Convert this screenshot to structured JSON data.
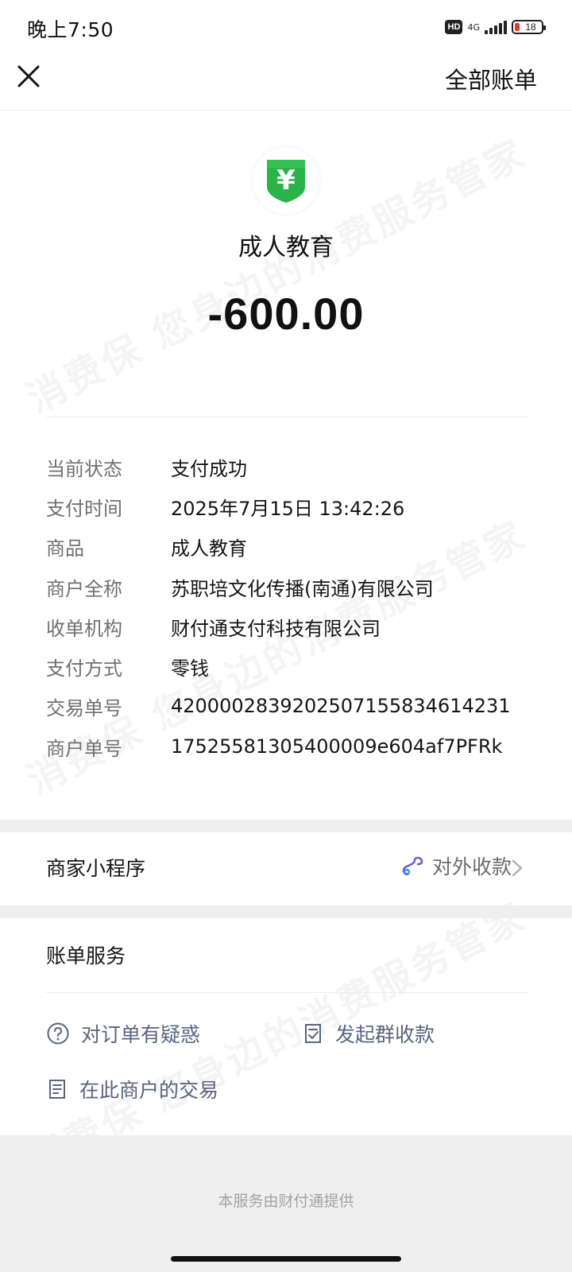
{
  "status_bar": {
    "time": "晚上7:50",
    "hd": "HD",
    "network": "4G",
    "battery": "18"
  },
  "header": {
    "right_link": "全部账单"
  },
  "merchant": {
    "name": "成人教育",
    "amount": "-600.00",
    "logo_symbol": "¥",
    "logo_color": "#2bb34a"
  },
  "details": [
    {
      "label": "当前状态",
      "value": "支付成功"
    },
    {
      "label": "支付时间",
      "value": "2025年7月15日 13:42:26"
    },
    {
      "label": "商品",
      "value": "成人教育"
    },
    {
      "label": "商户全称",
      "value": "苏职培文化传播(南通)有限公司"
    },
    {
      "label": "收单机构",
      "value": "财付通支付科技有限公司"
    },
    {
      "label": "支付方式",
      "value": "零钱"
    },
    {
      "label": "交易单号",
      "value": "4200002839202507155834614231"
    },
    {
      "label": "商户单号",
      "value": "17525581305400009e604af7PFRk"
    }
  ],
  "mini_program": {
    "title": "商家小程序",
    "link_label": "对外收款"
  },
  "bill_service": {
    "title": "账单服务",
    "items": [
      {
        "label": "对订单有疑惑",
        "icon": "question-icon"
      },
      {
        "label": "发起群收款",
        "icon": "checklist-icon"
      },
      {
        "label": "在此商户的交易",
        "icon": "document-icon"
      }
    ]
  },
  "footer": {
    "text": "本服务由财付通提供"
  },
  "watermark": "消费保 您身边的消费服务管家",
  "colors": {
    "link": "#58657f",
    "accent_green": "#2bb34a",
    "battery_low": "#e53935"
  }
}
